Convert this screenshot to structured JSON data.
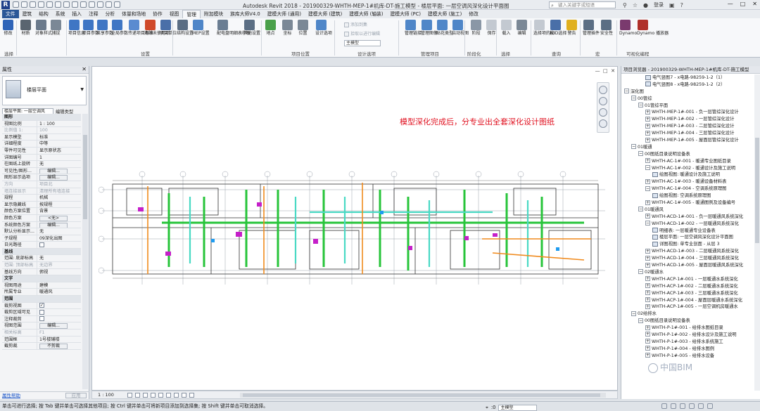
{
  "window": {
    "title": "Autodesk Revit 2018 -    201900329-WHTH-MEP-1#机库-DT-施工模型 - 楼层平面: 一层空调风深化设计平面图",
    "search_placeholder": "键入关键字或短语",
    "login": "登录",
    "controls": [
      "—",
      "□",
      "✕"
    ]
  },
  "tabs": [
    "文件",
    "建筑",
    "结构",
    "系统",
    "插入",
    "注释",
    "分析",
    "体量和场地",
    "协作",
    "视图",
    "管理",
    "附加模块",
    "族库大师V4.0",
    "建模大师 (通用)",
    "建模大师 (建筑)",
    "建模大师 (轴装)",
    "建模大师 (PC)",
    "建模大师 (施工)",
    "修改"
  ],
  "active_tab": "管理",
  "ribbon": {
    "tools": [
      {
        "label": "修改",
        "color": "#2f64b8"
      },
      {
        "label": "材质",
        "color": "#5a6570"
      },
      {
        "label": "对象样式",
        "color": "#6b7a8c"
      },
      {
        "label": "捕捉",
        "color": "#7b8896"
      },
      {
        "label": "项目信息",
        "color": "#3f76c4"
      },
      {
        "label": "项目参数",
        "color": "#3f76c4"
      },
      {
        "label": "共享参数",
        "color": "#3f76c4"
      },
      {
        "label": "全局参数",
        "color": "#3f76c4"
      },
      {
        "label": "传递项目标准",
        "color": "#5a8bd0"
      },
      {
        "label": "清除未使用项",
        "color": "#d04a2a"
      },
      {
        "label": "项目单位",
        "color": "#4a6fa8"
      },
      {
        "label": "结构设置",
        "color": "#5b6e84"
      },
      {
        "label": "MEP设置",
        "color": "#4f86c8"
      },
      {
        "label": "配电盘明细表样板",
        "color": "#6a7d92"
      },
      {
        "label": "其他设置",
        "color": "#5b6e84"
      },
      {
        "label": "地点",
        "color": "#4aa04a"
      },
      {
        "label": "坐标",
        "color": "#7b8896"
      },
      {
        "label": "位置",
        "color": "#7b8896"
      },
      {
        "label": "设计选项",
        "color": "#4f86c8"
      },
      {
        "label": "管理链接",
        "color": "#4f86c8"
      },
      {
        "label": "管理图像",
        "color": "#4f86c8"
      },
      {
        "label": "贴花类型",
        "color": "#4f86c8"
      },
      {
        "label": "启动视图",
        "color": "#4f86c8"
      },
      {
        "label": "阶段",
        "color": "#8a97a6"
      },
      {
        "label": "保存",
        "color": "#c3c9d1"
      },
      {
        "label": "载入",
        "color": "#c3c9d1"
      },
      {
        "label": "编辑",
        "color": "#7b8896"
      },
      {
        "label": "选择项的ID",
        "color": "#c3c9d1"
      },
      {
        "label": "按ID选择",
        "color": "#4a6fa8"
      },
      {
        "label": "警告",
        "color": "#e0b020"
      },
      {
        "label": "管理插件",
        "color": "#5b6e84"
      },
      {
        "label": "安全性",
        "color": "#5b6e84"
      },
      {
        "label": "Dynamo",
        "color": "#7a3a6e"
      },
      {
        "label": "Dynamo 播放器",
        "color": "#b0302a"
      }
    ],
    "panels": [
      "选择",
      "设置",
      "项目位置",
      "设计选项",
      "管理项目",
      "阶段化",
      "选择",
      "查询",
      "宏",
      "可视化编程"
    ],
    "design_options": {
      "add_to_set": "添加到集",
      "pick_to_edit": "拾取以进行编辑",
      "main_model": "主模型"
    }
  },
  "properties": {
    "title": "属性",
    "type_name": "楼层平面",
    "filter": "楼层平面: 一层空调风",
    "edit_type": "编辑类型",
    "rows": [
      {
        "k": "图形",
        "v": "",
        "kind": "section"
      },
      {
        "k": "视图比例",
        "v": "1 : 100"
      },
      {
        "k": "比例值 1:",
        "v": "100",
        "kind": "grey"
      },
      {
        "k": "显示模型",
        "v": "标准"
      },
      {
        "k": "详细程度",
        "v": "中等"
      },
      {
        "k": "零件可见性",
        "v": "显示原状态"
      },
      {
        "k": "详图编号",
        "v": "1"
      },
      {
        "k": "在图纸上旋转",
        "v": "无"
      },
      {
        "k": "可见性/图形...",
        "v": "编辑...",
        "kind": "button"
      },
      {
        "k": "图形显示选项",
        "v": "编辑...",
        "kind": "button"
      },
      {
        "k": "方向",
        "v": "项目北",
        "kind": "grey"
      },
      {
        "k": "墙连接显示",
        "v": "清理所有墙连接",
        "kind": "grey"
      },
      {
        "k": "规程",
        "v": "机械"
      },
      {
        "k": "显示隐藏线",
        "v": "按规程"
      },
      {
        "k": "颜色方案位置",
        "v": "背景"
      },
      {
        "k": "颜色方案",
        "v": "<无>",
        "kind": "button"
      },
      {
        "k": "系统颜色方案",
        "v": "编辑...",
        "kind": "button"
      },
      {
        "k": "默认分析显示...",
        "v": "无"
      },
      {
        "k": "子规程",
        "v": "09深化出图"
      },
      {
        "k": "日光路径",
        "v": "",
        "kind": "check"
      },
      {
        "k": "基线",
        "v": "",
        "kind": "section"
      },
      {
        "k": "范围: 底部标高",
        "v": "无"
      },
      {
        "k": "范围: 顶部标高",
        "v": "无边界",
        "kind": "grey"
      },
      {
        "k": "基线方向",
        "v": "俯视"
      },
      {
        "k": "文字",
        "v": "",
        "kind": "section"
      },
      {
        "k": "视图用途",
        "v": "建模"
      },
      {
        "k": "所属专业",
        "v": "暖通风"
      },
      {
        "k": "范围",
        "v": "",
        "kind": "section"
      },
      {
        "k": "裁剪视图",
        "v": "✓",
        "kind": "check"
      },
      {
        "k": "裁剪区域可见",
        "v": "",
        "kind": "check"
      },
      {
        "k": "注释裁剪",
        "v": "",
        "kind": "check"
      },
      {
        "k": "视图范围",
        "v": "编辑...",
        "kind": "button"
      },
      {
        "k": "相关标高",
        "v": "F1",
        "kind": "grey"
      },
      {
        "k": "范围框",
        "v": "1号楼辅楼"
      },
      {
        "k": "截剪裁",
        "v": "不剪裁",
        "kind": "button"
      }
    ],
    "help_link": "属性帮助",
    "apply": "应用"
  },
  "canvas": {
    "annotation": "模型深化完成后，分专业出全套深化设计图纸",
    "scale": "1 : 100",
    "controls": [
      "—",
      "□",
      "✕"
    ]
  },
  "browser": {
    "title": "项目浏览器 - 201900329-WHTH-MEP-1#机库-DT-施工模型",
    "items": [
      {
        "level": 4,
        "label": "电气竖图7 - x电路-98259-1-2（1）",
        "type": "view"
      },
      {
        "level": 4,
        "label": "电气竖图8 - x电路-98259-1-2（2）",
        "type": "view"
      },
      {
        "level": 1,
        "label": "深化图",
        "toggle": "−"
      },
      {
        "level": 2,
        "label": "00管综",
        "toggle": "−"
      },
      {
        "level": 3,
        "label": "01管综平面",
        "toggle": "−"
      },
      {
        "level": 4,
        "label": "WHTH-MEP-1#-001 - 负一层管综深化设计",
        "toggle": "+"
      },
      {
        "level": 4,
        "label": "WHTH-MEP-1#-002 - 一层管综深化设计",
        "toggle": "+"
      },
      {
        "level": 4,
        "label": "WHTH-MEP-1#-003 - 二层管综深化设计",
        "toggle": "+"
      },
      {
        "level": 4,
        "label": "WHTH-MEP-1#-004 - 三层管综深化设计",
        "toggle": "+"
      },
      {
        "level": 4,
        "label": "WHTH-MEP-1#-005 - 屋面层管综深化设计",
        "toggle": "+"
      },
      {
        "level": 2,
        "label": "01暖通",
        "toggle": "−"
      },
      {
        "level": 3,
        "label": "00图纸目录说明设备表",
        "toggle": "−"
      },
      {
        "level": 4,
        "label": "WHTH-AC-1#-001 - 暖通专业图纸目录",
        "toggle": "+"
      },
      {
        "level": 4,
        "label": "WHTH-AC-1#-002 - 暖通设计及施工说明",
        "toggle": "−"
      },
      {
        "level": 5,
        "label": "绘图视图: 暖通设计及施工说明",
        "type": "view"
      },
      {
        "level": 4,
        "label": "WHTH-AC-1#-003 - 暖通设备材料表",
        "toggle": "+"
      },
      {
        "level": 4,
        "label": "WHTH-AC-1#-004 - 空调系统原理图",
        "toggle": "−"
      },
      {
        "level": 5,
        "label": "绘图视图: 空调系统原理图",
        "type": "view"
      },
      {
        "level": 4,
        "label": "WHTH-AC-1#-005 - 暖通图例及设备编号",
        "toggle": "+"
      },
      {
        "level": 3,
        "label": "01暖通风",
        "toggle": "−"
      },
      {
        "level": 4,
        "label": "WHTH-ACD-1#-001 - 负一层暖通风系统深化",
        "toggle": "+"
      },
      {
        "level": 4,
        "label": "WHTH-ACD-1#-002 - 一层暖通风系统深化",
        "toggle": "−"
      },
      {
        "level": 5,
        "label": "明细表: 一层暖通专业设备表",
        "type": "view"
      },
      {
        "level": 5,
        "label": "楼层平面: 一层空调风深化设计平面图",
        "type": "view"
      },
      {
        "level": 5,
        "label": "详图视图: 单专业剖面 - 从层 3",
        "type": "view"
      },
      {
        "level": 4,
        "label": "WHTH-ACD-1#-003 - 二层暖通风系统深化",
        "toggle": "+"
      },
      {
        "level": 4,
        "label": "WHTH-ACD-1#-004 - 三层暖通风系统深化",
        "toggle": "+"
      },
      {
        "level": 4,
        "label": "WHTH-ACD-1#-005 - 屋面层暖通风系统深化",
        "toggle": "+"
      },
      {
        "level": 3,
        "label": "02暖通水",
        "toggle": "−"
      },
      {
        "level": 4,
        "label": "WHTH-ACP-1#-001 - 一层暖通水系统深化",
        "toggle": "+"
      },
      {
        "level": 4,
        "label": "WHTH-ACP-1#-002 - 二层暖通水系统深化",
        "toggle": "+"
      },
      {
        "level": 4,
        "label": "WHTH-ACP-1#-003 - 三层暖通水系统深化",
        "toggle": "+"
      },
      {
        "level": 4,
        "label": "WHTH-ACP-1#-004 - 屋面层暖通水系统深化",
        "toggle": "+"
      },
      {
        "level": 4,
        "label": "WHTH-ACP-1#-005 - 一层空调机房暖通水",
        "toggle": "+"
      },
      {
        "level": 2,
        "label": "02给排水",
        "toggle": "−"
      },
      {
        "level": 3,
        "label": "00图纸目录说明设备表",
        "toggle": "−"
      },
      {
        "level": 4,
        "label": "WHTH-P-1#-001 - 给排水图纸目录",
        "toggle": "+"
      },
      {
        "level": 4,
        "label": "WHTH-P-1#-002 - 给排水设计及施工说明",
        "toggle": "+"
      },
      {
        "level": 4,
        "label": "WHTH-P-1#-003 - 给排水系统施工",
        "toggle": "+"
      },
      {
        "level": 4,
        "label": "WHTH-P-1#-004 - 给排水图例",
        "toggle": "+"
      },
      {
        "level": 4,
        "label": "WHTH-P-1#-005 - 给排水设备",
        "toggle": "+"
      }
    ],
    "watermark": "中国BIM"
  },
  "statusbar": {
    "message": "单击可进行选择; 按 Tab 键并单击可选择其他项目; 按 Ctrl 键并单击可将新项目添加到选择集; 按 Shift 键并单击可取消选择。",
    "zero": ":0",
    "workset": "主模型"
  }
}
